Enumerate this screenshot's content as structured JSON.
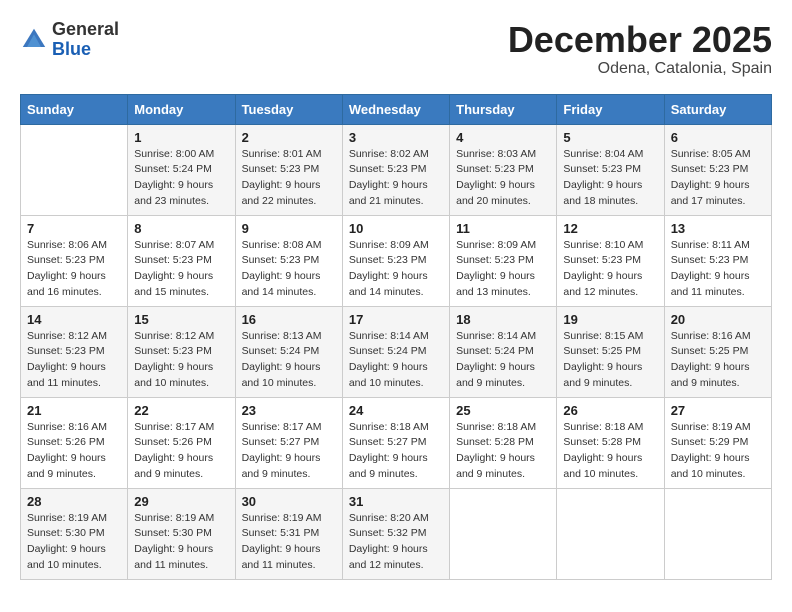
{
  "header": {
    "logo": {
      "general": "General",
      "blue": "Blue"
    },
    "title": "December 2025",
    "location": "Odena, Catalonia, Spain"
  },
  "weekdays": [
    "Sunday",
    "Monday",
    "Tuesday",
    "Wednesday",
    "Thursday",
    "Friday",
    "Saturday"
  ],
  "weeks": [
    [
      null,
      {
        "day": "1",
        "sunrise": "Sunrise: 8:00 AM",
        "sunset": "Sunset: 5:24 PM",
        "daylight": "Daylight: 9 hours and 23 minutes."
      },
      {
        "day": "2",
        "sunrise": "Sunrise: 8:01 AM",
        "sunset": "Sunset: 5:23 PM",
        "daylight": "Daylight: 9 hours and 22 minutes."
      },
      {
        "day": "3",
        "sunrise": "Sunrise: 8:02 AM",
        "sunset": "Sunset: 5:23 PM",
        "daylight": "Daylight: 9 hours and 21 minutes."
      },
      {
        "day": "4",
        "sunrise": "Sunrise: 8:03 AM",
        "sunset": "Sunset: 5:23 PM",
        "daylight": "Daylight: 9 hours and 20 minutes."
      },
      {
        "day": "5",
        "sunrise": "Sunrise: 8:04 AM",
        "sunset": "Sunset: 5:23 PM",
        "daylight": "Daylight: 9 hours and 18 minutes."
      },
      {
        "day": "6",
        "sunrise": "Sunrise: 8:05 AM",
        "sunset": "Sunset: 5:23 PM",
        "daylight": "Daylight: 9 hours and 17 minutes."
      }
    ],
    [
      {
        "day": "7",
        "sunrise": "Sunrise: 8:06 AM",
        "sunset": "Sunset: 5:23 PM",
        "daylight": "Daylight: 9 hours and 16 minutes."
      },
      {
        "day": "8",
        "sunrise": "Sunrise: 8:07 AM",
        "sunset": "Sunset: 5:23 PM",
        "daylight": "Daylight: 9 hours and 15 minutes."
      },
      {
        "day": "9",
        "sunrise": "Sunrise: 8:08 AM",
        "sunset": "Sunset: 5:23 PM",
        "daylight": "Daylight: 9 hours and 14 minutes."
      },
      {
        "day": "10",
        "sunrise": "Sunrise: 8:09 AM",
        "sunset": "Sunset: 5:23 PM",
        "daylight": "Daylight: 9 hours and 14 minutes."
      },
      {
        "day": "11",
        "sunrise": "Sunrise: 8:09 AM",
        "sunset": "Sunset: 5:23 PM",
        "daylight": "Daylight: 9 hours and 13 minutes."
      },
      {
        "day": "12",
        "sunrise": "Sunrise: 8:10 AM",
        "sunset": "Sunset: 5:23 PM",
        "daylight": "Daylight: 9 hours and 12 minutes."
      },
      {
        "day": "13",
        "sunrise": "Sunrise: 8:11 AM",
        "sunset": "Sunset: 5:23 PM",
        "daylight": "Daylight: 9 hours and 11 minutes."
      }
    ],
    [
      {
        "day": "14",
        "sunrise": "Sunrise: 8:12 AM",
        "sunset": "Sunset: 5:23 PM",
        "daylight": "Daylight: 9 hours and 11 minutes."
      },
      {
        "day": "15",
        "sunrise": "Sunrise: 8:12 AM",
        "sunset": "Sunset: 5:23 PM",
        "daylight": "Daylight: 9 hours and 10 minutes."
      },
      {
        "day": "16",
        "sunrise": "Sunrise: 8:13 AM",
        "sunset": "Sunset: 5:24 PM",
        "daylight": "Daylight: 9 hours and 10 minutes."
      },
      {
        "day": "17",
        "sunrise": "Sunrise: 8:14 AM",
        "sunset": "Sunset: 5:24 PM",
        "daylight": "Daylight: 9 hours and 10 minutes."
      },
      {
        "day": "18",
        "sunrise": "Sunrise: 8:14 AM",
        "sunset": "Sunset: 5:24 PM",
        "daylight": "Daylight: 9 hours and 9 minutes."
      },
      {
        "day": "19",
        "sunrise": "Sunrise: 8:15 AM",
        "sunset": "Sunset: 5:25 PM",
        "daylight": "Daylight: 9 hours and 9 minutes."
      },
      {
        "day": "20",
        "sunrise": "Sunrise: 8:16 AM",
        "sunset": "Sunset: 5:25 PM",
        "daylight": "Daylight: 9 hours and 9 minutes."
      }
    ],
    [
      {
        "day": "21",
        "sunrise": "Sunrise: 8:16 AM",
        "sunset": "Sunset: 5:26 PM",
        "daylight": "Daylight: 9 hours and 9 minutes."
      },
      {
        "day": "22",
        "sunrise": "Sunrise: 8:17 AM",
        "sunset": "Sunset: 5:26 PM",
        "daylight": "Daylight: 9 hours and 9 minutes."
      },
      {
        "day": "23",
        "sunrise": "Sunrise: 8:17 AM",
        "sunset": "Sunset: 5:27 PM",
        "daylight": "Daylight: 9 hours and 9 minutes."
      },
      {
        "day": "24",
        "sunrise": "Sunrise: 8:18 AM",
        "sunset": "Sunset: 5:27 PM",
        "daylight": "Daylight: 9 hours and 9 minutes."
      },
      {
        "day": "25",
        "sunrise": "Sunrise: 8:18 AM",
        "sunset": "Sunset: 5:28 PM",
        "daylight": "Daylight: 9 hours and 9 minutes."
      },
      {
        "day": "26",
        "sunrise": "Sunrise: 8:18 AM",
        "sunset": "Sunset: 5:28 PM",
        "daylight": "Daylight: 9 hours and 10 minutes."
      },
      {
        "day": "27",
        "sunrise": "Sunrise: 8:19 AM",
        "sunset": "Sunset: 5:29 PM",
        "daylight": "Daylight: 9 hours and 10 minutes."
      }
    ],
    [
      {
        "day": "28",
        "sunrise": "Sunrise: 8:19 AM",
        "sunset": "Sunset: 5:30 PM",
        "daylight": "Daylight: 9 hours and 10 minutes."
      },
      {
        "day": "29",
        "sunrise": "Sunrise: 8:19 AM",
        "sunset": "Sunset: 5:30 PM",
        "daylight": "Daylight: 9 hours and 11 minutes."
      },
      {
        "day": "30",
        "sunrise": "Sunrise: 8:19 AM",
        "sunset": "Sunset: 5:31 PM",
        "daylight": "Daylight: 9 hours and 11 minutes."
      },
      {
        "day": "31",
        "sunrise": "Sunrise: 8:20 AM",
        "sunset": "Sunset: 5:32 PM",
        "daylight": "Daylight: 9 hours and 12 minutes."
      },
      null,
      null,
      null
    ]
  ]
}
